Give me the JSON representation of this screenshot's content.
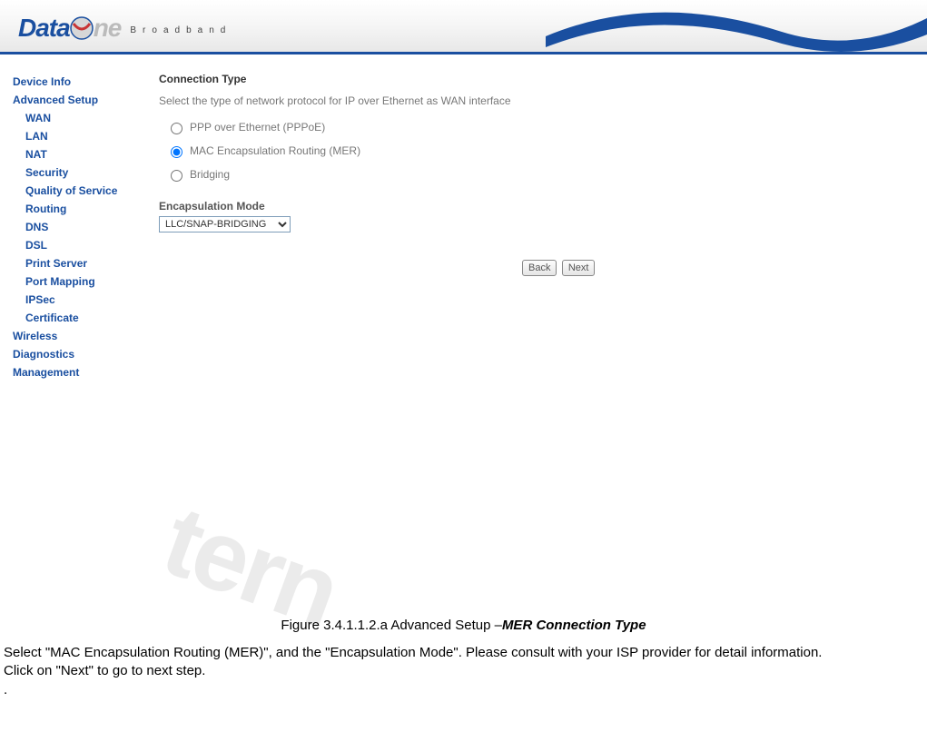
{
  "logo": {
    "word1": "Data",
    "word2": "ne",
    "tagline": "Broadband"
  },
  "sidebar": {
    "device_info": "Device Info",
    "advanced_setup": "Advanced Setup",
    "sub": {
      "wan": "WAN",
      "lan": "LAN",
      "nat": "NAT",
      "security": "Security",
      "qos": "Quality of Service",
      "routing": "Routing",
      "dns": "DNS",
      "dsl": "DSL",
      "print_server": "Print Server",
      "port_mapping": "Port Mapping",
      "ipsec": "IPSec",
      "certificate": "Certificate"
    },
    "wireless": "Wireless",
    "diagnostics": "Diagnostics",
    "management": "Management"
  },
  "main": {
    "title": "Connection Type",
    "helper": "Select the type of network protocol for IP over Ethernet as WAN interface",
    "radios": {
      "pppoe": "PPP over Ethernet (PPPoE)",
      "mer": "MAC Encapsulation Routing (MER)",
      "bridging": "Bridging"
    },
    "encap_label": "Encapsulation Mode",
    "encap_value": "LLC/SNAP-BRIDGING",
    "back": "Back",
    "next": "Next"
  },
  "caption": {
    "prefix": "Figure 3.4.1.1.2.a Advanced Setup –",
    "emph": "MER Connection Type"
  },
  "body": {
    "p1": "Select \"MAC Encapsulation Routing (MER)\", and the \"Encapsulation Mode\". Please consult with your ISP provider for detail information.",
    "p2": "Click on \"Next\" to go to next step.",
    "p3": "."
  },
  "watermark": "tern"
}
